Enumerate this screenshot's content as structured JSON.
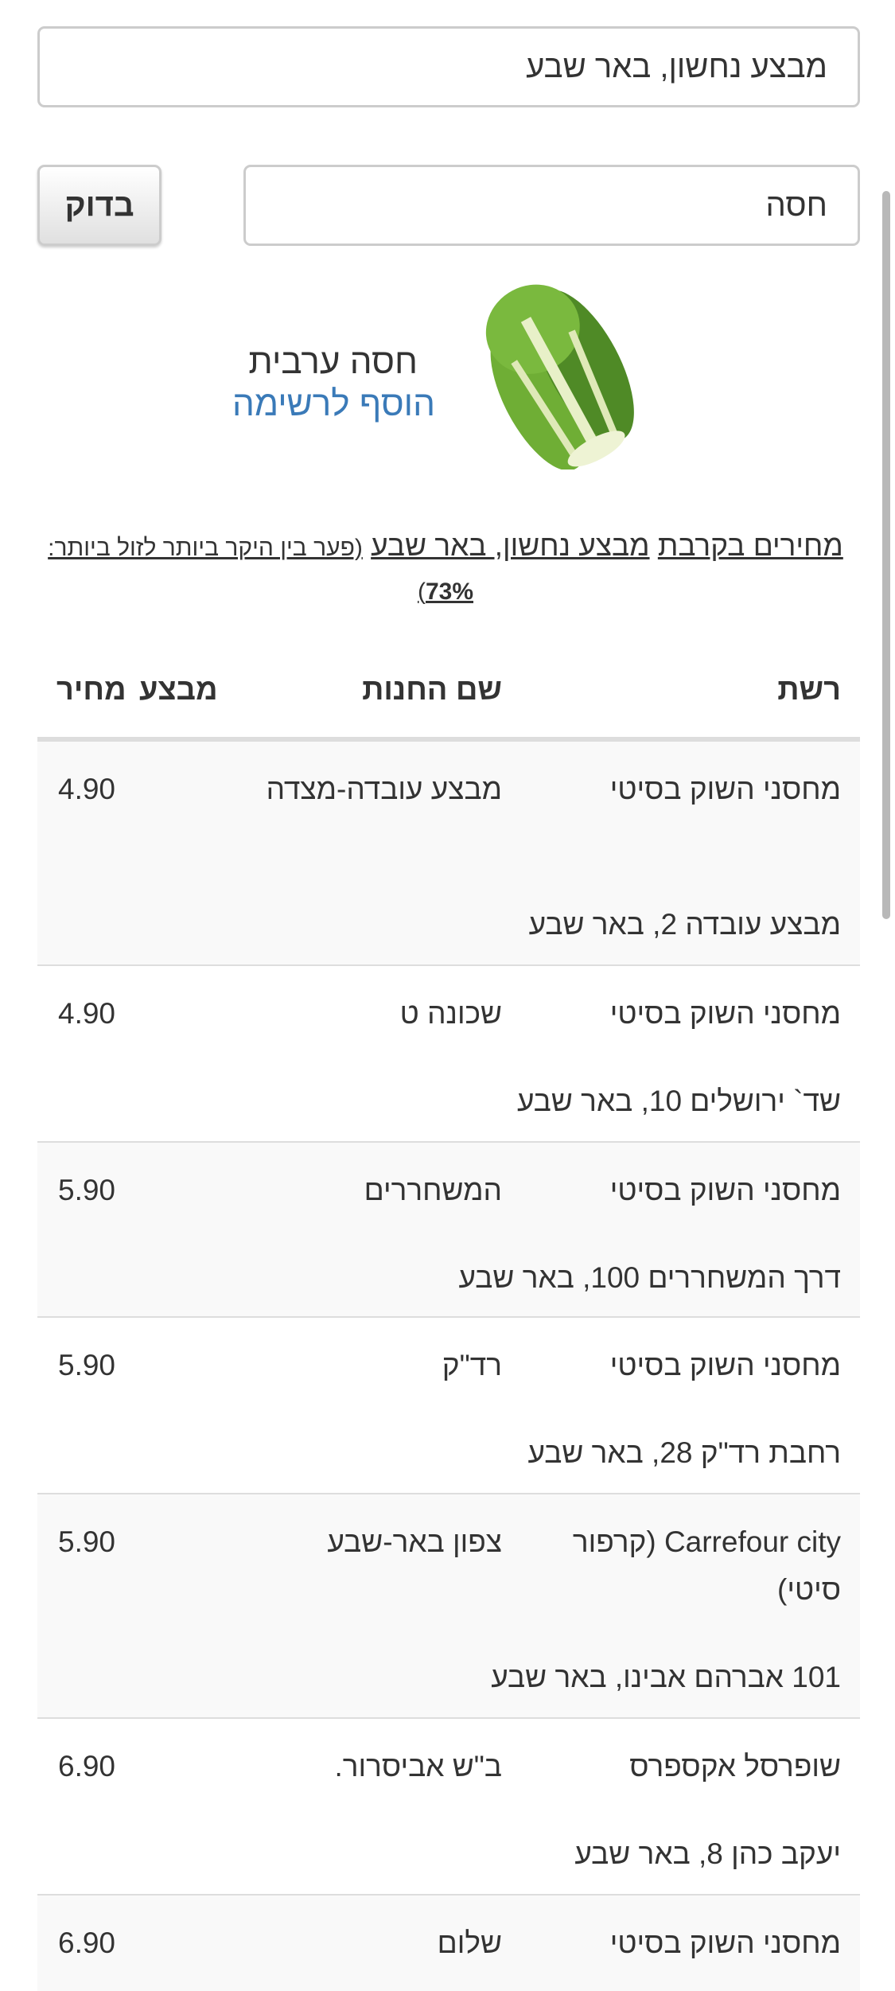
{
  "search": {
    "location_value": "מבצע נחשון, באר שבע",
    "query_value": "חסה",
    "check_button": "בדוק"
  },
  "product": {
    "name": "חסה ערבית",
    "add_to_list": "הוסף לרשימה",
    "image": "romaine-lettuce"
  },
  "nearby": {
    "prefix": "מחירים בקרבת",
    "place": "מבצע נחשון, באר שבע",
    "gap_label": "(פער בין היקר ביותר לזול ביותר:",
    "gap_value": "73%",
    "gap_close": ")"
  },
  "table": {
    "headers": {
      "chain": "רשת",
      "store": "שם החנות",
      "deal": "מבצע",
      "price": "מחיר"
    },
    "rows": [
      {
        "chain": "מחסני השוק בסיטי",
        "store": "מבצע עובדה-מצדה",
        "price": "4.90",
        "address": "מבצע עובדה 2, באר שבע"
      },
      {
        "chain": "מחסני השוק בסיטי",
        "store": "שכונה ט",
        "price": "4.90",
        "address": "שד` ירושלים 10, באר שבע"
      },
      {
        "chain": "מחסני השוק בסיטי",
        "store": "המשחררים",
        "price": "5.90",
        "address": "דרך המשחררים 100, באר שבע"
      },
      {
        "chain": "מחסני השוק בסיטי",
        "store": "רד\"ק",
        "price": "5.90",
        "address": "רחבת רד\"ק 28, באר שבע"
      },
      {
        "chain": "Carrefour city (קרפור סיטי)",
        "store": "צפון באר-שבע",
        "price": "5.90",
        "address": "101 אברהם אבינו, באר שבע"
      },
      {
        "chain": "שופרסל אקספרס",
        "store": "ב\"ש אביסרור.",
        "price": "6.90",
        "address": "יעקב כהן 8, באר שבע"
      },
      {
        "chain": "מחסני השוק בסיטי",
        "store": "שלום",
        "price": "6.90",
        "address": ""
      }
    ]
  },
  "colors": {
    "link": "#3a7ab8",
    "text": "#333333",
    "row_alt": "#f9f9f9",
    "border": "#dddddd"
  }
}
